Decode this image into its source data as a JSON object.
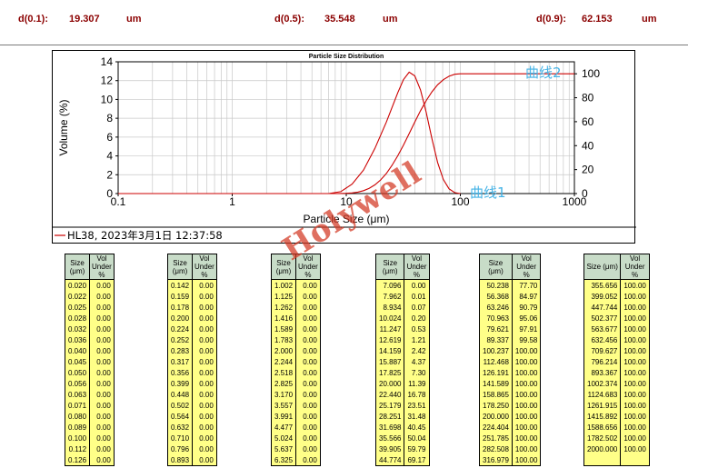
{
  "percentiles": [
    {
      "label": "d(0.1):",
      "value": "19.307",
      "unit": "um"
    },
    {
      "label": "d(0.5):",
      "value": "35.548",
      "unit": "um"
    },
    {
      "label": "d(0.9):",
      "value": "62.153",
      "unit": "um"
    }
  ],
  "watermark": "Holywell",
  "chart_data": {
    "type": "line",
    "title": "Particle Size Distribution",
    "xlabel": "Particle Size (μm)",
    "ylabel": "Volume (%)",
    "x_scale": "log",
    "xlim": [
      0.1,
      1000
    ],
    "x_ticks": [
      "0.1",
      "1",
      "10",
      "100",
      "1000"
    ],
    "ylim": [
      0,
      14
    ],
    "y_ticks": [
      "0",
      "2",
      "4",
      "6",
      "8",
      "10",
      "12",
      "14"
    ],
    "y2lim": [
      0,
      110
    ],
    "y2_ticks": [
      "0",
      "20",
      "40",
      "60",
      "80",
      "100"
    ],
    "grid": true,
    "legend": "HL38, 2023年3月1日  12:37:58",
    "legend_position": "bottom-left",
    "line_color": "#cc0000",
    "series": [
      {
        "axis": "left",
        "annotation": "曲线1",
        "x": [
          0.1,
          7.0,
          8.934,
          11.247,
          14.159,
          17.825,
          22.44,
          28.251,
          31.698,
          35.566,
          39.905,
          44.774,
          50.238,
          56.368,
          63.246,
          70.963,
          79.621,
          89.337,
          100.237
        ],
        "y": [
          0,
          0,
          0.2,
          1.0,
          2.5,
          4.8,
          7.6,
          10.7,
          12.1,
          12.9,
          12.5,
          11.0,
          8.6,
          5.8,
          3.3,
          1.5,
          0.5,
          0.1,
          0
        ]
      },
      {
        "axis": "right",
        "annotation": "曲线2",
        "x": [
          0.1,
          7.096,
          7.962,
          8.934,
          10.024,
          11.247,
          12.619,
          14.159,
          15.887,
          17.825,
          20.0,
          22.44,
          25.179,
          28.251,
          31.698,
          35.566,
          39.905,
          44.774,
          50.238,
          56.368,
          63.246,
          70.963,
          79.621,
          89.337,
          100.237,
          1000
        ],
        "y": [
          0,
          0,
          0.01,
          0.07,
          0.2,
          0.53,
          1.21,
          2.42,
          4.37,
          7.3,
          11.39,
          16.78,
          23.51,
          31.48,
          40.45,
          50.04,
          59.79,
          69.17,
          77.7,
          84.97,
          90.79,
          95.06,
          97.91,
          99.58,
          100,
          100
        ]
      }
    ]
  },
  "table": {
    "headers": [
      "Size (μm)",
      "Vol Under %"
    ],
    "columns": [
      [
        [
          "0.020",
          "0.00"
        ],
        [
          "0.022",
          "0.00"
        ],
        [
          "0.025",
          "0.00"
        ],
        [
          "0.028",
          "0.00"
        ],
        [
          "0.032",
          "0.00"
        ],
        [
          "0.036",
          "0.00"
        ],
        [
          "0.040",
          "0.00"
        ],
        [
          "0.045",
          "0.00"
        ],
        [
          "0.050",
          "0.00"
        ],
        [
          "0.056",
          "0.00"
        ],
        [
          "0.063",
          "0.00"
        ],
        [
          "0.071",
          "0.00"
        ],
        [
          "0.080",
          "0.00"
        ],
        [
          "0.089",
          "0.00"
        ],
        [
          "0.100",
          "0.00"
        ],
        [
          "0.112",
          "0.00"
        ],
        [
          "0.126",
          "0.00"
        ]
      ],
      [
        [
          "0.142",
          "0.00"
        ],
        [
          "0.159",
          "0.00"
        ],
        [
          "0.178",
          "0.00"
        ],
        [
          "0.200",
          "0.00"
        ],
        [
          "0.224",
          "0.00"
        ],
        [
          "0.252",
          "0.00"
        ],
        [
          "0.283",
          "0.00"
        ],
        [
          "0.317",
          "0.00"
        ],
        [
          "0.356",
          "0.00"
        ],
        [
          "0.399",
          "0.00"
        ],
        [
          "0.448",
          "0.00"
        ],
        [
          "0.502",
          "0.00"
        ],
        [
          "0.564",
          "0.00"
        ],
        [
          "0.632",
          "0.00"
        ],
        [
          "0.710",
          "0.00"
        ],
        [
          "0.796",
          "0.00"
        ],
        [
          "0.893",
          "0.00"
        ]
      ],
      [
        [
          "1.002",
          "0.00"
        ],
        [
          "1.125",
          "0.00"
        ],
        [
          "1.262",
          "0.00"
        ],
        [
          "1.416",
          "0.00"
        ],
        [
          "1.589",
          "0.00"
        ],
        [
          "1.783",
          "0.00"
        ],
        [
          "2.000",
          "0.00"
        ],
        [
          "2.244",
          "0.00"
        ],
        [
          "2.518",
          "0.00"
        ],
        [
          "2.825",
          "0.00"
        ],
        [
          "3.170",
          "0.00"
        ],
        [
          "3.557",
          "0.00"
        ],
        [
          "3.991",
          "0.00"
        ],
        [
          "4.477",
          "0.00"
        ],
        [
          "5.024",
          "0.00"
        ],
        [
          "5.637",
          "0.00"
        ],
        [
          "6.325",
          "0.00"
        ]
      ],
      [
        [
          "7.096",
          "0.00"
        ],
        [
          "7.962",
          "0.01"
        ],
        [
          "8.934",
          "0.07"
        ],
        [
          "10.024",
          "0.20"
        ],
        [
          "11.247",
          "0.53"
        ],
        [
          "12.619",
          "1.21"
        ],
        [
          "14.159",
          "2.42"
        ],
        [
          "15.887",
          "4.37"
        ],
        [
          "17.825",
          "7.30"
        ],
        [
          "20.000",
          "11.39"
        ],
        [
          "22.440",
          "16.78"
        ],
        [
          "25.179",
          "23.51"
        ],
        [
          "28.251",
          "31.48"
        ],
        [
          "31.698",
          "40.45"
        ],
        [
          "35.566",
          "50.04"
        ],
        [
          "39.905",
          "59.79"
        ],
        [
          "44.774",
          "69.17"
        ]
      ],
      [
        [
          "50.238",
          "77.70"
        ],
        [
          "56.368",
          "84.97"
        ],
        [
          "63.246",
          "90.79"
        ],
        [
          "70.963",
          "95.06"
        ],
        [
          "79.621",
          "97.91"
        ],
        [
          "89.337",
          "99.58"
        ],
        [
          "100.237",
          "100.00"
        ],
        [
          "112.468",
          "100.00"
        ],
        [
          "126.191",
          "100.00"
        ],
        [
          "141.589",
          "100.00"
        ],
        [
          "158.865",
          "100.00"
        ],
        [
          "178.250",
          "100.00"
        ],
        [
          "200.000",
          "100.00"
        ],
        [
          "224.404",
          "100.00"
        ],
        [
          "251.785",
          "100.00"
        ],
        [
          "282.508",
          "100.00"
        ],
        [
          "316.979",
          "100.00"
        ]
      ],
      [
        [
          "355.656",
          "100.00"
        ],
        [
          "399.052",
          "100.00"
        ],
        [
          "447.744",
          "100.00"
        ],
        [
          "502.377",
          "100.00"
        ],
        [
          "563.677",
          "100.00"
        ],
        [
          "632.456",
          "100.00"
        ],
        [
          "709.627",
          "100.00"
        ],
        [
          "796.214",
          "100.00"
        ],
        [
          "893.367",
          "100.00"
        ],
        [
          "1002.374",
          "100.00"
        ],
        [
          "1124.683",
          "100.00"
        ],
        [
          "1261.915",
          "100.00"
        ],
        [
          "1415.892",
          "100.00"
        ],
        [
          "1588.656",
          "100.00"
        ],
        [
          "1782.502",
          "100.00"
        ],
        [
          "2000.000",
          "100.00"
        ],
        [
          "",
          "",
          ""
        ]
      ]
    ]
  }
}
